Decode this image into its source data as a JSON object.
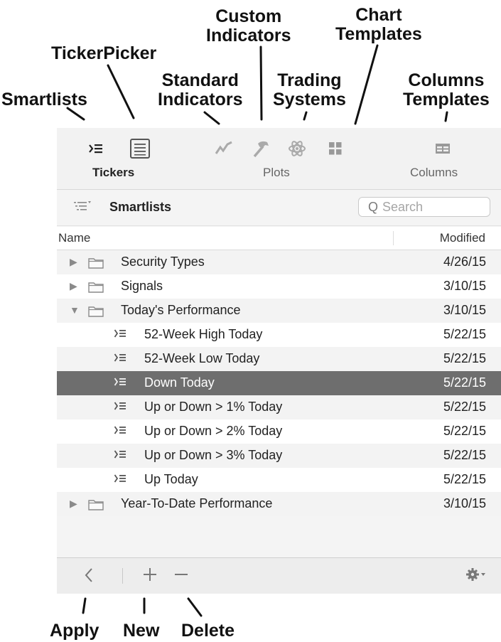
{
  "callouts": {
    "smartlists": "Smartlists",
    "tickerpicker": "TickerPicker",
    "standard_indicators": [
      "Standard",
      "Indicators"
    ],
    "custom_indicators": [
      "Custom",
      "Indicators"
    ],
    "trading_systems": [
      "Trading",
      "Systems"
    ],
    "chart_templates": [
      "Chart",
      "Templates"
    ],
    "columns_templates": [
      "Columns",
      "Templates"
    ],
    "apply": "Apply",
    "new": "New",
    "delete": "Delete"
  },
  "tabs": [
    {
      "label": "Tickers",
      "active": true
    },
    {
      "label": "Plots",
      "active": false
    },
    {
      "label": "Columns",
      "active": false
    }
  ],
  "header": {
    "title": "Smartlists",
    "search_placeholder": "Search"
  },
  "columns": {
    "name": "Name",
    "modified": "Modified"
  },
  "rows": [
    {
      "type": "folder",
      "disclosure": "▶",
      "name": "Security Types",
      "date": "4/26/15"
    },
    {
      "type": "folder",
      "disclosure": "▶",
      "name": "Signals",
      "date": "3/10/15"
    },
    {
      "type": "folder",
      "disclosure": "▼",
      "name": "Today's Performance",
      "date": "3/10/15"
    },
    {
      "type": "list",
      "name": "52-Week High Today",
      "date": "5/22/15"
    },
    {
      "type": "list",
      "name": "52-Week Low Today",
      "date": "5/22/15"
    },
    {
      "type": "list",
      "name": "Down Today",
      "date": "5/22/15",
      "selected": true
    },
    {
      "type": "list",
      "name": "Up or Down > 1% Today",
      "date": "5/22/15"
    },
    {
      "type": "list",
      "name": "Up or Down > 2% Today",
      "date": "5/22/15"
    },
    {
      "type": "list",
      "name": "Up or Down > 3% Today",
      "date": "5/22/15"
    },
    {
      "type": "list",
      "name": "Up Today",
      "date": "5/22/15"
    },
    {
      "type": "folder",
      "disclosure": "▶",
      "name": "Year-To-Date Performance",
      "date": "3/10/15"
    }
  ],
  "footer": {
    "apply_icon": "chevron-left-icon",
    "new_icon": "plus-icon",
    "delete_icon": "minus-icon",
    "settings_icon": "gear-icon"
  },
  "colors": {
    "selected_row": "#6e6e6e",
    "alt_row": "#f3f3f3"
  }
}
